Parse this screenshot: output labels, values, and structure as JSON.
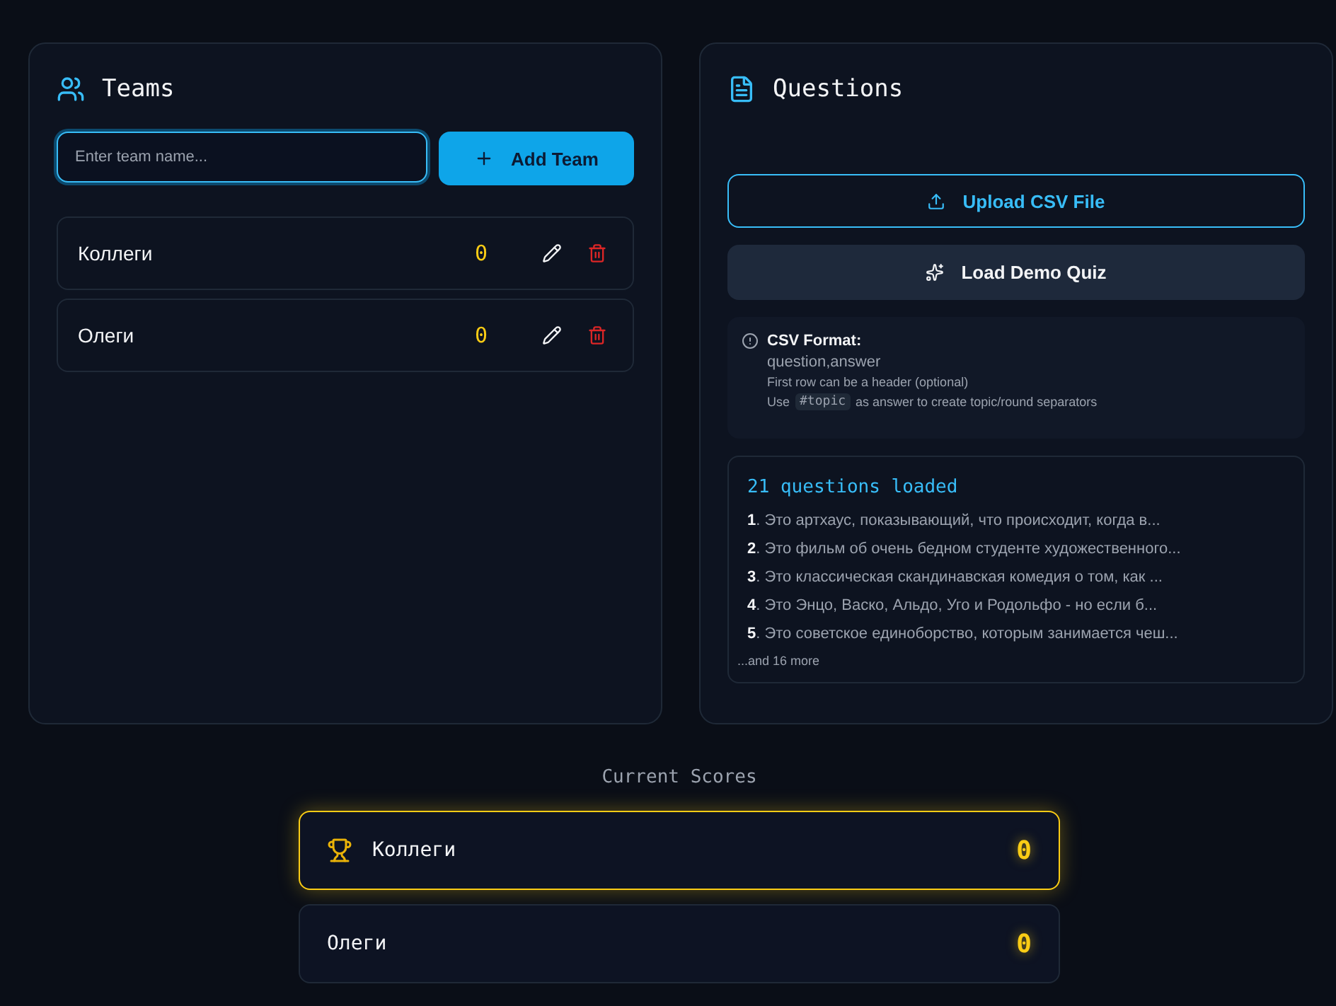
{
  "teams_panel": {
    "title": "Teams",
    "input": {
      "placeholder": "Enter team name...",
      "focused": true
    },
    "add_button": "Add Team",
    "teams": [
      {
        "name": "Коллеги",
        "score": "0"
      },
      {
        "name": "Олеги",
        "score": "0"
      }
    ]
  },
  "questions_panel": {
    "title": "Questions",
    "upload_button": "Upload CSV File",
    "demo_button": "Load Demo Quiz",
    "format_note": {
      "title": "CSV Format:",
      "example": "question,answer",
      "hint": "First row can be a header (optional)",
      "usage_before": "Use",
      "usage_code": "#topic",
      "usage_after": "as answer to create topic/round separators"
    },
    "loaded": {
      "title": "21 questions loaded",
      "items": [
        "**1**. Это артхаус, показывающий, что происходит, когда в...",
        "**2**. Это фильм об очень бедном студенте художественного...",
        "**3**. Это классическая скандинавская комедия о том, как ...",
        "**4**. Это Энцо, Васко, Альдо, Уго и Родольфо - но если б...",
        "**5**. Это советское единоборство, которым занимается чеш..."
      ],
      "more": "...and 16 more"
    }
  },
  "scores": {
    "title": "Current Scores",
    "rows": [
      {
        "name": "Коллеги",
        "score": "0",
        "leader": true
      },
      {
        "name": "Олеги",
        "score": "0",
        "leader": false
      }
    ]
  }
}
